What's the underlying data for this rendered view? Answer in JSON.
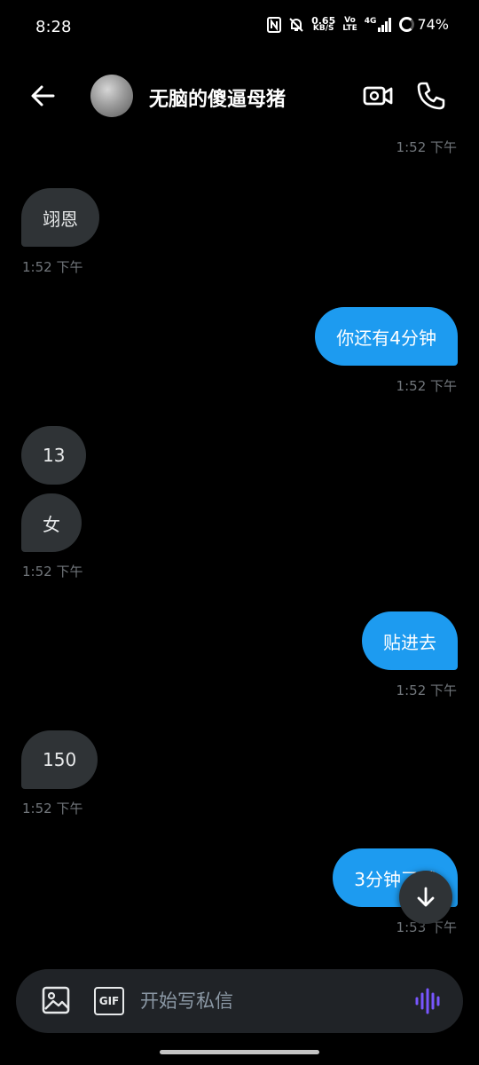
{
  "status_bar": {
    "time": "8:28",
    "net_speed_value": "0.65",
    "net_speed_unit": "KB/S",
    "volte_top": "Vo",
    "volte_bottom": "LTE",
    "signal_label": "4G",
    "battery": "74%"
  },
  "header": {
    "contact_name": "无脑的傻逼母猪"
  },
  "messages": [
    {
      "direction": "in",
      "timestamp": "1:52 下午"
    },
    {
      "direction": "in",
      "text": "翊恩",
      "timestamp": "1:52 下午"
    },
    {
      "direction": "out",
      "text": "你还有4分钟",
      "timestamp": "1:52 下午"
    },
    {
      "direction": "in",
      "text": "13"
    },
    {
      "direction": "in",
      "text": "女",
      "timestamp": "1:52 下午"
    },
    {
      "direction": "out",
      "text": "贴进去",
      "timestamp": "1:52 下午"
    },
    {
      "direction": "in",
      "text": "150",
      "timestamp": "1:52 下午"
    },
    {
      "direction": "out",
      "text": "3分钟了哦",
      "timestamp": "1:53 下午"
    }
  ],
  "composer": {
    "placeholder": "开始写私信",
    "gif_label": "GIF"
  },
  "colors": {
    "background": "#000000",
    "incoming_bubble": "#2f3336",
    "outgoing_bubble": "#1d9bf0",
    "timestamp": "#71767b",
    "voice_accent": "#7856ff"
  },
  "icons": {
    "back": "arrow-left-icon",
    "video_call": "video-camera-icon",
    "voice_call": "phone-icon",
    "scroll_down": "arrow-down-icon",
    "media": "image-icon",
    "gif": "gif-icon",
    "voice": "voice-wave-icon"
  }
}
